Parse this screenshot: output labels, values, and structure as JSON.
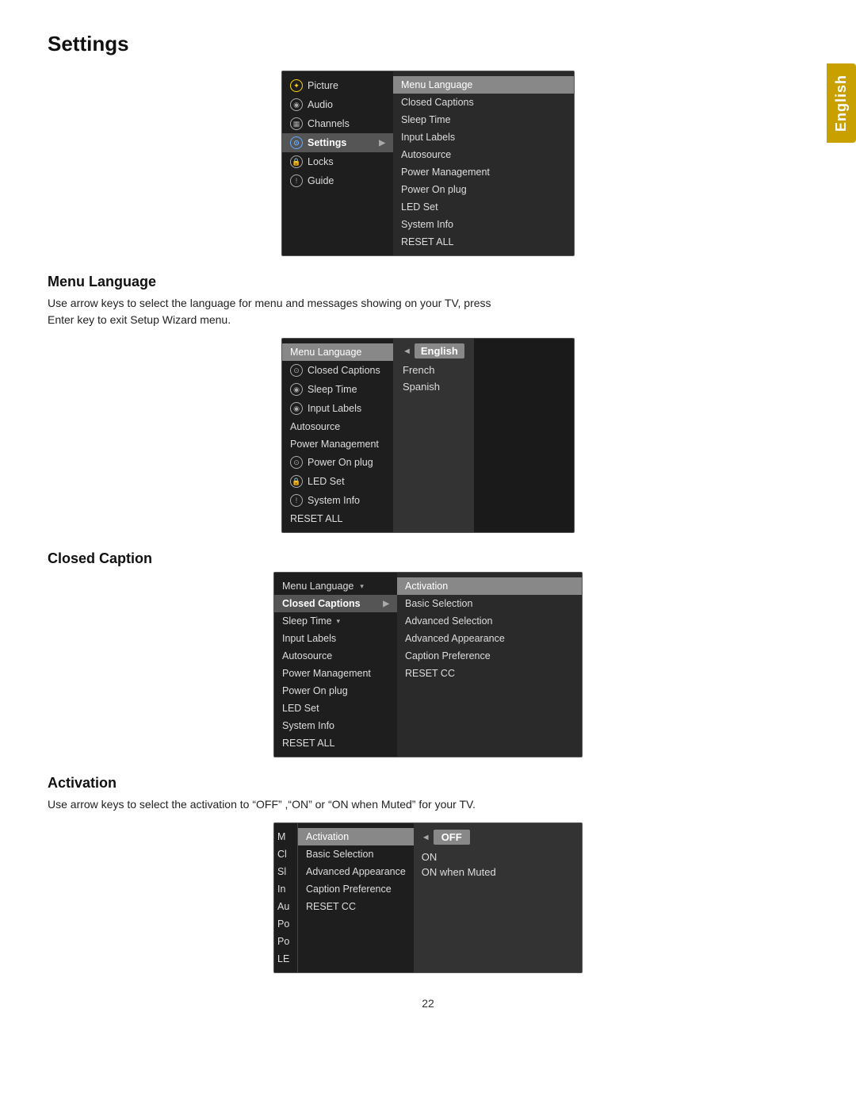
{
  "page": {
    "title": "Settings",
    "english_tab": "English",
    "page_number": "22"
  },
  "sections": {
    "menu_language": {
      "heading": "Menu Language",
      "description": "Use arrow keys to select the language for menu and messages showing on your TV, press\nEnter key to exit Setup Wizard menu."
    },
    "closed_caption": {
      "heading": "Closed Caption"
    },
    "activation": {
      "heading": "Activation",
      "description": "Use arrow keys to select the activation to “OFF” ,“ON” or “ON when Muted” for your TV."
    }
  },
  "screenshot1": {
    "left_items": [
      {
        "icon": "sun",
        "label": "Picture",
        "selected": false
      },
      {
        "icon": "audio",
        "label": "Audio",
        "selected": false
      },
      {
        "icon": "channels",
        "label": "Channels",
        "selected": false
      },
      {
        "icon": "settings",
        "label": "Settings",
        "selected": true
      },
      {
        "icon": "locks",
        "label": "Locks",
        "selected": false
      },
      {
        "icon": "guide",
        "label": "Guide",
        "selected": false
      }
    ],
    "right_items": [
      "Menu Language",
      "Closed Captions",
      "Sleep Time",
      "Input Labels",
      "Autosource",
      "Power Management",
      "Power On plug",
      "LED Set",
      "System Info",
      "RESET ALL"
    ]
  },
  "screenshot2": {
    "left_items": [
      "Menu Language",
      "Closed Captions",
      "Sleep Time",
      "Input Labels",
      "Autosource",
      "Power Management",
      "Power On plug",
      "LED Set",
      "System Info",
      "RESET ALL"
    ],
    "right_items": [
      "English",
      "French",
      "Spanish"
    ]
  },
  "screenshot3": {
    "left_items": [
      "Menu Language",
      "Closed Captions",
      "Sleep Time",
      "Input Labels",
      "Autosource",
      "Power Management",
      "Power On plug",
      "LED Set",
      "System Info",
      "RESET ALL"
    ],
    "right_items": [
      "Activation",
      "Basic Selection",
      "Advanced Selection",
      "Advanced Appearance",
      "Caption Preference",
      "RESET CC"
    ]
  },
  "screenshot4": {
    "left_items": [
      "Activation",
      "Basic Selection",
      "Advanced Appearance",
      "Caption Preference",
      "RESET CC"
    ],
    "right_items": [
      "OFF",
      "ON",
      "ON when Muted"
    ],
    "partial_left": [
      "M",
      "Cl",
      "Sl",
      "In",
      "Au",
      "Po",
      "Po",
      "LE"
    ]
  }
}
